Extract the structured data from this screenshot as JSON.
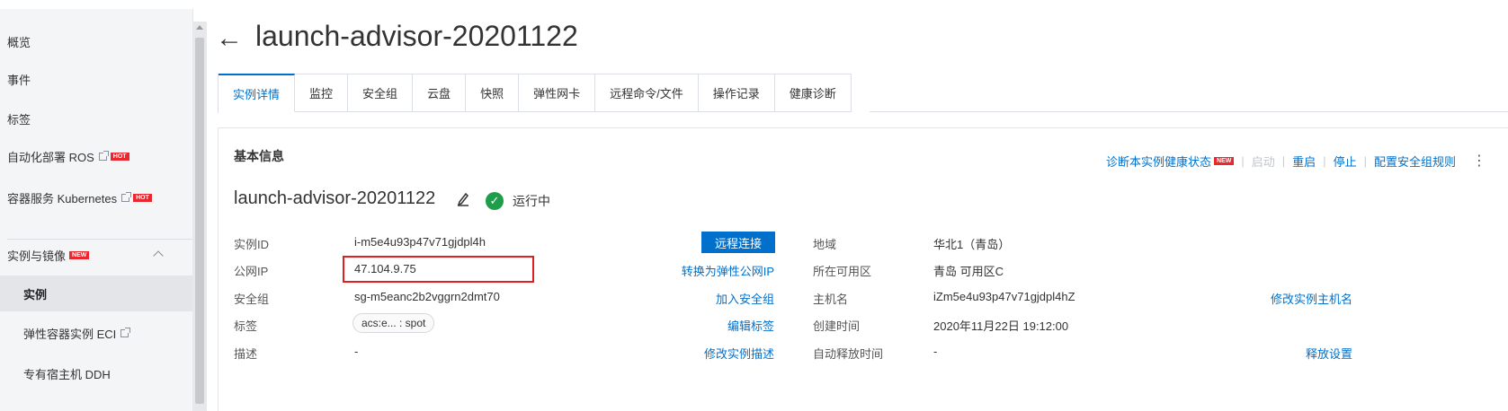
{
  "sidebar": {
    "items": [
      {
        "label": "概览"
      },
      {
        "label": "事件"
      },
      {
        "label": "标签"
      },
      {
        "label": "自动化部署 ROS",
        "badge": "HOT"
      },
      {
        "label": "容器服务 Kubernetes",
        "badge": "HOT"
      },
      {
        "label": "实例与镜像",
        "badge": "NEW"
      },
      {
        "label": "实例"
      },
      {
        "label": "弹性容器实例 ECI"
      },
      {
        "label": "专有宿主机 DDH"
      }
    ]
  },
  "header": {
    "back_icon": "arrow-left-icon",
    "title": "launch-advisor-20201122"
  },
  "tabs": [
    "实例详情",
    "监控",
    "安全组",
    "云盘",
    "快照",
    "弹性网卡",
    "远程命令/文件",
    "操作记录",
    "健康诊断"
  ],
  "basic_info": {
    "section_title": "基本信息",
    "actions": {
      "diagnose": "诊断本实例健康状态",
      "diagnose_badge": "NEW",
      "start": "启动",
      "restart": "重启",
      "stop": "停止",
      "config_sg": "配置安全组规则"
    },
    "instance_name": "launch-advisor-20201122",
    "status": "运行中",
    "status_color": "#1e9e4a",
    "left": [
      {
        "label": "实例ID",
        "value": "i-m5e4u93p47v71gjdpl4h"
      },
      {
        "label": "公网IP",
        "value": "47.104.9.75"
      },
      {
        "label": "安全组",
        "value": "sg-m5eanc2b2vggrn2dmt70"
      },
      {
        "label": "标签",
        "value": "acs:e... : spot"
      },
      {
        "label": "描述",
        "value": "-"
      }
    ],
    "mid_links": {
      "remote_connect": "远程连接",
      "convert_eip": "转换为弹性公网IP",
      "join_sg": "加入安全组",
      "edit_tags": "编辑标签",
      "edit_desc": "修改实例描述"
    },
    "right": [
      {
        "label": "地域",
        "value": "华北1（青岛）"
      },
      {
        "label": "所在可用区",
        "value": "青岛 可用区C"
      },
      {
        "label": "主机名",
        "value": "iZm5e4u93p47v71gjdpl4hZ"
      },
      {
        "label": "创建时间",
        "value": "2020年11月22日 19:12:00"
      },
      {
        "label": "自动释放时间",
        "value": "-"
      }
    ],
    "right_links": {
      "edit_hostname": "修改实例主机名",
      "release_settings": "释放设置"
    }
  },
  "colors": {
    "accent": "#0070cc",
    "hot_badge": "#e8272e",
    "highlight_box": "#e02020"
  }
}
